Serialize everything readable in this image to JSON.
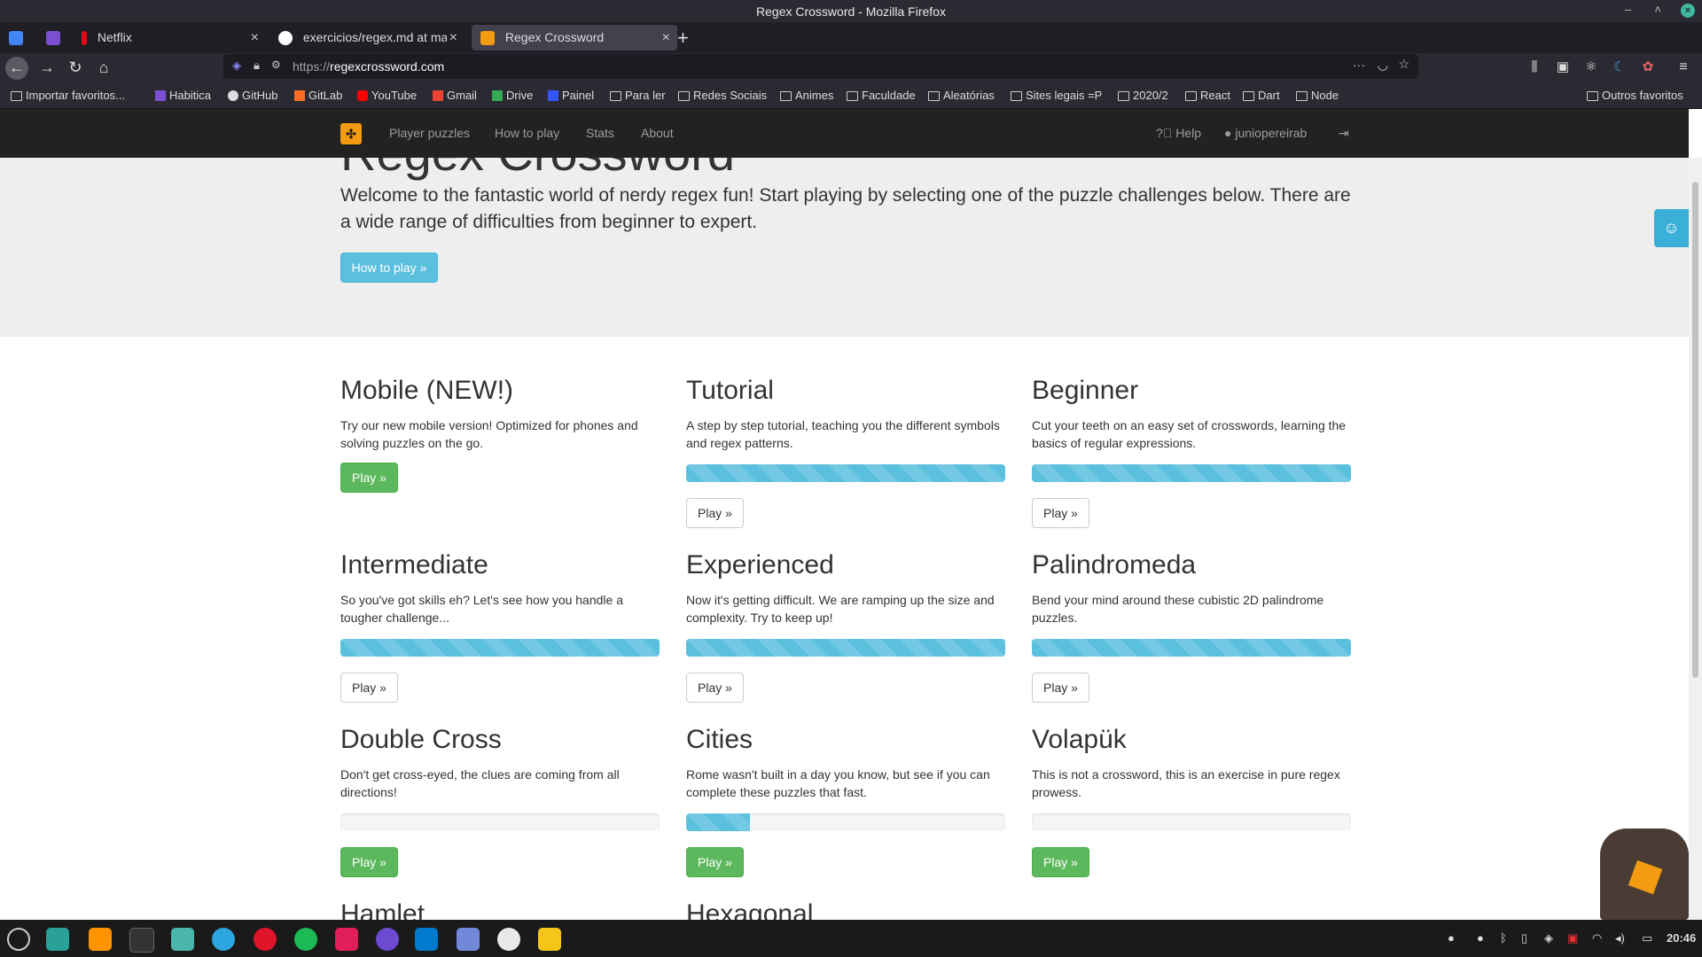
{
  "window": {
    "title": "Regex Crossword - Mozilla Firefox"
  },
  "tabs": [
    {
      "label": "",
      "favicon_color": "#7b4fd1"
    },
    {
      "label": "Netflix",
      "favicon_color": "#e50914"
    },
    {
      "label": "exercicios/regex.md at mas",
      "favicon_color": "#ffffff"
    },
    {
      "label": "Regex Crossword",
      "favicon_color": "#f39c12"
    }
  ],
  "urlbar": {
    "url_prefix": "https://",
    "url_host": "regexcrossword.com"
  },
  "bookmarks": [
    "Importar favoritos...",
    "Habitica",
    "GitHub",
    "GitLab",
    "YouTube",
    "Gmail",
    "Drive",
    "Painel",
    "Para ler",
    "Redes Sociais",
    "Animes",
    "Faculdade",
    "Aleatórias",
    "Sites legais =P",
    "2020/2",
    "React",
    "Dart",
    "Node"
  ],
  "bookmarks_other": "Outros favoritos",
  "site_nav": {
    "links": [
      "Player puzzles",
      "How to play",
      "Stats",
      "About"
    ],
    "help": "Help",
    "user": "juniopereirab"
  },
  "hero": {
    "title": "Regex Crossword",
    "intro": "Welcome to the fantastic world of nerdy regex fun! Start playing by selecting one of the puzzle challenges below. There are a wide range of difficulties from beginner to expert.",
    "button": "How to play »"
  },
  "puzzles": [
    {
      "title": "Mobile (NEW!)",
      "desc": "Try our new mobile version! Optimized for phones and solving puzzles on the go.",
      "progress": null,
      "button": "Play »",
      "style": "success"
    },
    {
      "title": "Tutorial",
      "desc": "A step by step tutorial, teaching you the different symbols and regex patterns.",
      "progress": 1.0,
      "button": "Play »",
      "style": "default"
    },
    {
      "title": "Beginner",
      "desc": "Cut your teeth on an easy set of crosswords, learning the basics of regular expressions.",
      "progress": 1.0,
      "button": "Play »",
      "style": "default"
    },
    {
      "title": "Intermediate",
      "desc": "So you've got skills eh? Let's see how you handle a tougher challenge...",
      "progress": 1.0,
      "button": "Play »",
      "style": "default"
    },
    {
      "title": "Experienced",
      "desc": "Now it's getting difficult. We are ramping up the size and complexity. Try to keep up!",
      "progress": 1.0,
      "button": "Play »",
      "style": "default"
    },
    {
      "title": "Palindromeda",
      "desc": "Bend your mind around these cubistic 2D palindrome puzzles.",
      "progress": 1.0,
      "button": "Play »",
      "style": "default"
    },
    {
      "title": "Double Cross",
      "desc": "Don't get cross-eyed, the clues are coming from all directions!",
      "progress": 0.0,
      "button": "Play »",
      "style": "success"
    },
    {
      "title": "Cities",
      "desc": "Rome wasn't built in a day you know, but see if you can complete these puzzles that fast.",
      "progress": 0.2,
      "button": "Play »",
      "style": "success"
    },
    {
      "title": "Volapük",
      "desc": "This is not a crossword, this is an exercise in pure regex prowess.",
      "progress": 0.0,
      "button": "Play »",
      "style": "success"
    },
    {
      "title": "Hamlet",
      "desc": "",
      "progress": null,
      "button": "",
      "style": "none"
    },
    {
      "title": "Hexagonal",
      "desc": "",
      "progress": null,
      "button": "",
      "style": "none"
    }
  ],
  "taskbar": {
    "clock": "20:46"
  },
  "colors": {
    "accent": "#5bc0de",
    "success": "#5cb85c",
    "brand": "#f39c12"
  }
}
